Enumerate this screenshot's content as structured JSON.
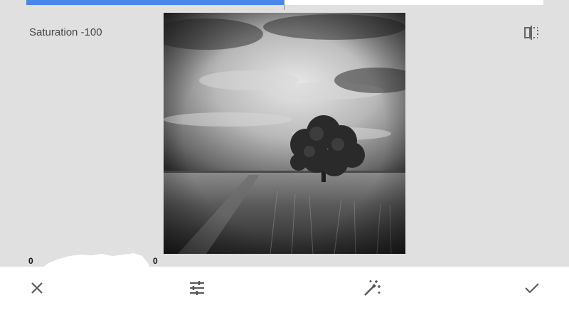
{
  "adjustment": {
    "label": "Saturation -100",
    "level": 0
  },
  "histogram": {
    "left_value": "0",
    "right_value": "0"
  },
  "compare": {
    "icon": "compare-icon"
  },
  "photo": {
    "description_icon": "photo-preview"
  },
  "toolbar": {
    "cancel_icon": "close-icon",
    "adjust_icon": "tune-icon",
    "auto_icon": "magic-wand-icon",
    "apply_icon": "check-icon"
  },
  "colors": {
    "accent": "#4a87e8",
    "background": "#e0e0e0",
    "toolbar": "#ffffff",
    "icon": "#555555"
  }
}
